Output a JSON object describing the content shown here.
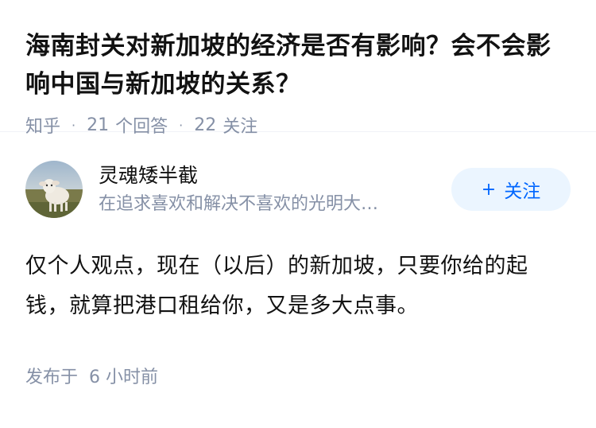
{
  "question": {
    "title": "海南封关对新加坡的经济是否有影响？会不会影响中国与新加坡的关系？",
    "source": "知乎",
    "answer_count": "21",
    "answer_label": "个回答",
    "follow_count": "22",
    "follow_label": "关注"
  },
  "answer": {
    "author": {
      "name": "灵魂矮半截",
      "bio": "在追求喜欢和解决不喜欢的光明大…",
      "avatar": "lamb-avatar"
    },
    "follow_button": {
      "icon": "+",
      "label": "关注"
    },
    "content": "仅个人观点，现在（以后）的新加坡，只要你给的起钱，就算把港口租给你，又是多大点事。",
    "published_label": "发布于",
    "published_time": "6 小时前"
  },
  "colors": {
    "accent": "#0066ff",
    "accent_bg": "#ebf5ff",
    "muted": "#8590a6",
    "text": "#121212"
  }
}
